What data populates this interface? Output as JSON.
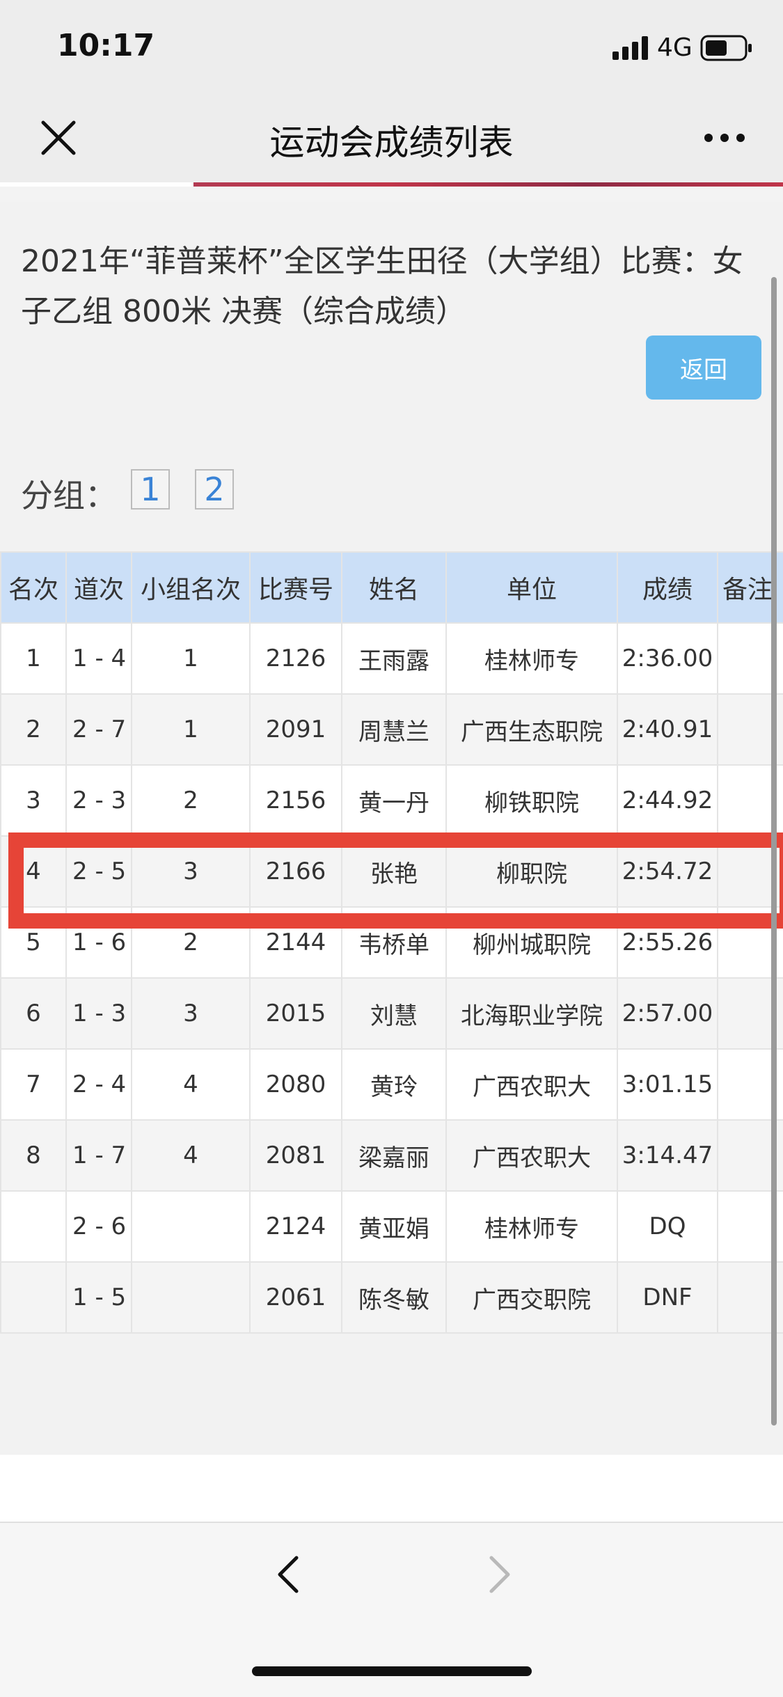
{
  "status_bar": {
    "time": "10:17",
    "network": "4G",
    "signal_icon": "cellular-signal-icon",
    "battery_icon": "battery-icon"
  },
  "nav": {
    "title": "运动会成绩列表",
    "close_icon": "close-icon",
    "more_icon": "more-icon"
  },
  "page": {
    "heading": "2021年“菲普莱杯”全区学生田径（大学组）比赛：女子乙组 800米 决赛（综合成绩）",
    "back_button": "返回",
    "group_label": "分组：",
    "groups": [
      "1",
      "2"
    ]
  },
  "table": {
    "headers": [
      "名次",
      "道次",
      "小组名次",
      "比赛号",
      "姓名",
      "单位",
      "成绩",
      "备注"
    ],
    "rows": [
      [
        "1",
        "1 - 4",
        "1",
        "2126",
        "王雨露",
        "桂林师专",
        "2:36.00",
        ""
      ],
      [
        "2",
        "2 - 7",
        "1",
        "2091",
        "周慧兰",
        "广西生态职院",
        "2:40.91",
        ""
      ],
      [
        "3",
        "2 - 3",
        "2",
        "2156",
        "黄一丹",
        "柳铁职院",
        "2:44.92",
        ""
      ],
      [
        "4",
        "2 - 5",
        "3",
        "2166",
        "张艳",
        "柳职院",
        "2:54.72",
        ""
      ],
      [
        "5",
        "1 - 6",
        "2",
        "2144",
        "韦桥单",
        "柳州城职院",
        "2:55.26",
        ""
      ],
      [
        "6",
        "1 - 3",
        "3",
        "2015",
        "刘慧",
        "北海职业学院",
        "2:57.00",
        ""
      ],
      [
        "7",
        "2 - 4",
        "4",
        "2080",
        "黄玲",
        "广西农职大",
        "3:01.15",
        ""
      ],
      [
        "8",
        "1 - 7",
        "4",
        "2081",
        "梁嘉丽",
        "广西农职大",
        "3:14.47",
        ""
      ],
      [
        "",
        "2 - 6",
        "",
        "2124",
        "黄亚娟",
        "桂林师专",
        "DQ",
        ""
      ],
      [
        "",
        "1 - 5",
        "",
        "2061",
        "陈冬敏",
        "广西交职院",
        "DNF",
        ""
      ]
    ],
    "highlighted_row": 4,
    "highlight_color": "#e64437",
    "header_color": "#cbdff7"
  },
  "bottom_nav": {
    "back_icon": "chevron-left-icon",
    "forward_icon": "chevron-right-icon"
  },
  "colors": {
    "accent_button": "#64b8ec",
    "link": "#3a83d6"
  }
}
